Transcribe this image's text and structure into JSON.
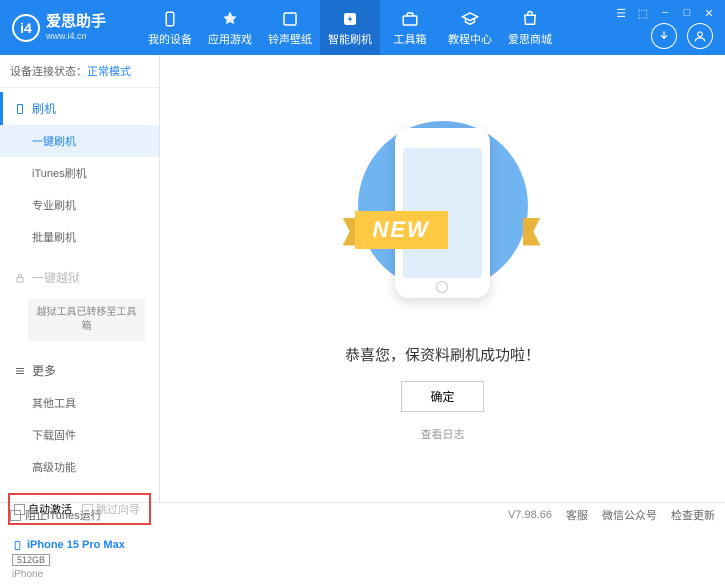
{
  "header": {
    "logo_text": "爱思助手",
    "logo_sub": "www.i4.cn",
    "nav": [
      {
        "label": "我的设备",
        "icon": "device"
      },
      {
        "label": "应用游戏",
        "icon": "apps"
      },
      {
        "label": "铃声壁纸",
        "icon": "media"
      },
      {
        "label": "智能刷机",
        "icon": "flash"
      },
      {
        "label": "工具箱",
        "icon": "toolbox"
      },
      {
        "label": "教程中心",
        "icon": "help"
      },
      {
        "label": "爱思商城",
        "icon": "shop"
      }
    ]
  },
  "status": {
    "label": "设备连接状态：",
    "mode": "正常模式"
  },
  "sidebar": {
    "flash_header": "刷机",
    "items_flash": [
      "一键刷机",
      "iTunes刷机",
      "专业刷机",
      "批量刷机"
    ],
    "jailbreak_header": "一键越狱",
    "jailbreak_note": "越狱工具已转移至工具箱",
    "more_header": "更多",
    "items_more": [
      "其他工具",
      "下载固件",
      "高级功能"
    ],
    "chk_auto": "自动激活",
    "chk_skip": "跳过向导"
  },
  "device": {
    "name": "iPhone 15 Pro Max",
    "storage": "512GB",
    "type": "iPhone"
  },
  "main": {
    "new_text": "NEW",
    "success": "恭喜您，保资料刷机成功啦！",
    "ok": "确定",
    "view_log": "查看日志"
  },
  "footer": {
    "block_itunes": "阻止iTunes运行",
    "version": "V7.98.66",
    "links": [
      "客服",
      "微信公众号",
      "检查更新"
    ]
  }
}
